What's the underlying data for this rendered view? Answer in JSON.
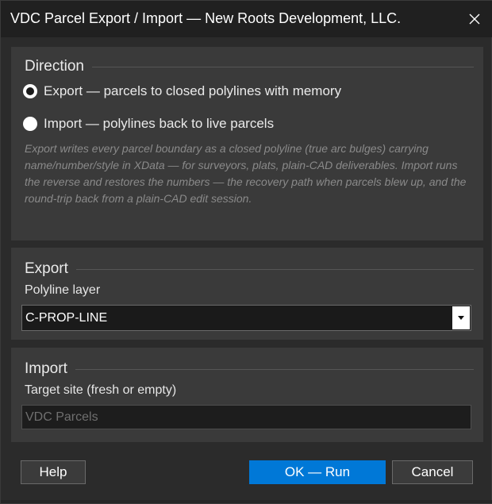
{
  "window": {
    "title": "VDC Parcel Export / Import — New Roots Development, LLC.",
    "close_glyph": "✕"
  },
  "direction": {
    "heading": "Direction",
    "options": [
      {
        "label": "Export — parcels to closed polylines with memory",
        "checked": true
      },
      {
        "label": "Import — polylines back to live parcels",
        "checked": false
      }
    ],
    "description": "Export writes every parcel boundary as a closed polyline (true arc bulges) carrying  name/number/style  in  XData — for surveyors, plats, plain-CAD deliverables. Import runs the reverse and restores the numbers — the recovery path when parcels blew up, and the round-trip back from a plain-CAD edit session."
  },
  "export": {
    "heading": "Export",
    "layer_label": "Polyline layer",
    "layer_value": "C-PROP-LINE"
  },
  "import": {
    "heading": "Import",
    "site_label": "Target site (fresh or empty)",
    "site_value": "VDC Parcels"
  },
  "buttons": {
    "help": "Help",
    "ok": "OK — Run",
    "cancel": "Cancel"
  },
  "colors": {
    "accent": "#0078d7",
    "background": "#2b2b2b",
    "panel": "#3a3a3a"
  }
}
